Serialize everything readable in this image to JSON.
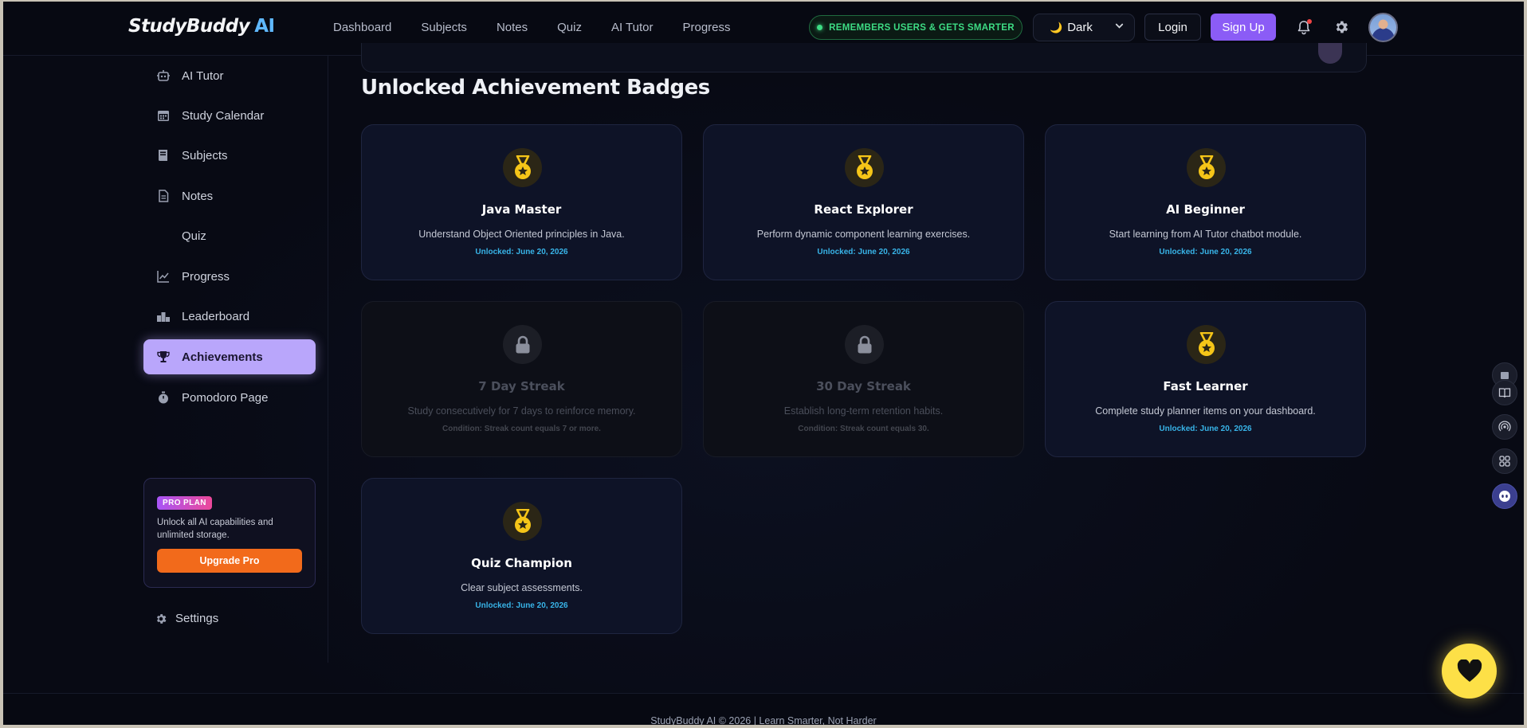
{
  "app": {
    "logo_text": "StudyBuddy",
    "logo_ai": "AI"
  },
  "nav": {
    "items": [
      "Dashboard",
      "Subjects",
      "Notes",
      "Quiz",
      "AI Tutor",
      "Progress"
    ]
  },
  "header": {
    "memory_pill": "REMEMBERS USERS & GETS SMARTER",
    "theme_value": "Dark",
    "login_label": "Login",
    "signup_label": "Sign Up"
  },
  "sidebar": {
    "items": [
      {
        "label": "AI Tutor",
        "icon": "robot-icon",
        "active": false
      },
      {
        "label": "Study Calendar",
        "icon": "calendar-icon",
        "active": false
      },
      {
        "label": "Subjects",
        "icon": "book-icon",
        "active": false
      },
      {
        "label": "Notes",
        "icon": "document-icon",
        "active": false
      },
      {
        "label": "Quiz",
        "icon": "",
        "active": false
      },
      {
        "label": "Progress",
        "icon": "line-chart-icon",
        "active": false
      },
      {
        "label": "Leaderboard",
        "icon": "podium-icon",
        "active": false
      },
      {
        "label": "Achievements",
        "icon": "trophy-icon",
        "active": true
      },
      {
        "label": "Pomodoro Page",
        "icon": "stopwatch-icon",
        "active": false
      }
    ],
    "pro": {
      "badge": "PRO PLAN",
      "text": "Unlock all AI capabilities and unlimited storage.",
      "button": "Upgrade Pro"
    },
    "settings_label": "Settings"
  },
  "main": {
    "section_title": "Unlocked Achievement Badges",
    "badges": [
      {
        "name": "Java Master",
        "description": "Understand Object Oriented principles in Java.",
        "meta": "Unlocked: June 20, 2026",
        "locked": false
      },
      {
        "name": "React Explorer",
        "description": "Perform dynamic component learning exercises.",
        "meta": "Unlocked: June 20, 2026",
        "locked": false
      },
      {
        "name": "AI Beginner",
        "description": "Start learning from AI Tutor chatbot module.",
        "meta": "Unlocked: June 20, 2026",
        "locked": false
      },
      {
        "name": "7 Day Streak",
        "description": "Study consecutively for 7 days to reinforce memory.",
        "meta": "Condition: Streak count equals 7 or more.",
        "locked": true
      },
      {
        "name": "30 Day Streak",
        "description": "Establish long-term retention habits.",
        "meta": "Condition: Streak count equals 30.",
        "locked": true
      },
      {
        "name": "Fast Learner",
        "description": "Complete study planner items on your dashboard.",
        "meta": "Unlocked: June 20, 2026",
        "locked": false
      },
      {
        "name": "Quiz Champion",
        "description": "Clear subject assessments.",
        "meta": "Unlocked: June 20, 2026",
        "locked": false
      }
    ]
  },
  "footer": {
    "text": "StudyBuddy AI © 2026 | Learn Smarter, Not Harder"
  },
  "colors": {
    "accent": "#8b5cf6",
    "active_item": "#b9a6fb",
    "unlocked_text": "#38b4e8",
    "memory_green": "#3ddc84",
    "upgrade_orange": "#f26a1b",
    "heart_fab": "#fde047"
  }
}
